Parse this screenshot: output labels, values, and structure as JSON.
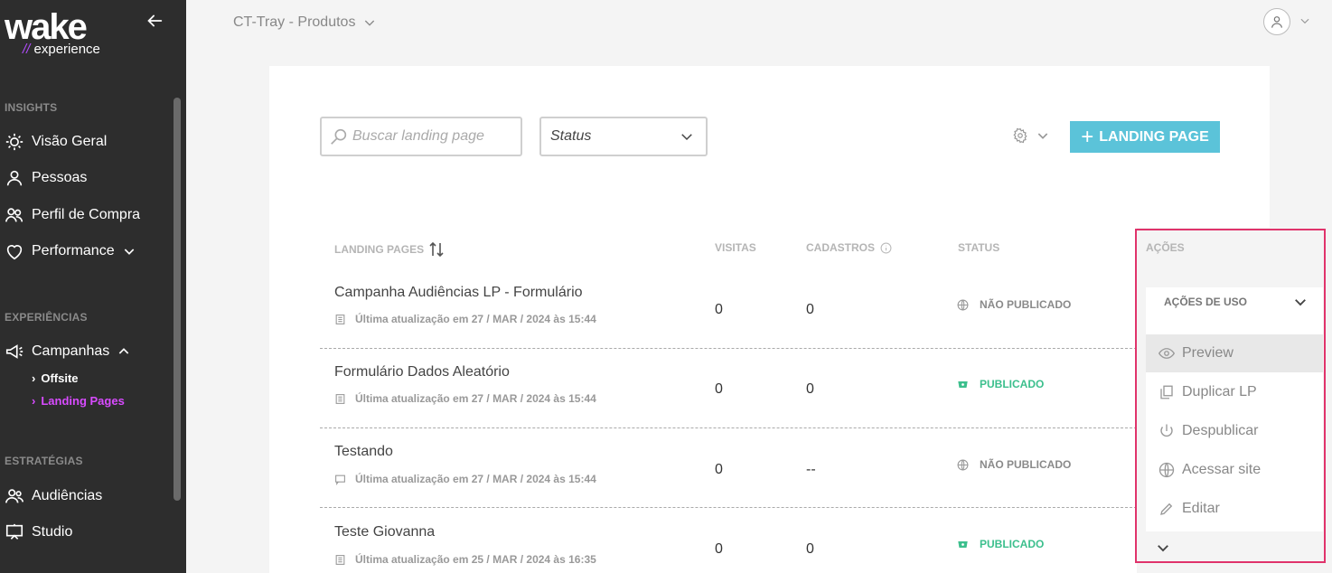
{
  "brand": {
    "logo_text": "wake",
    "logo_sub_slashes": "//",
    "logo_sub": "experience",
    "accent": "#d84bff"
  },
  "sidebar": {
    "sections": [
      {
        "label": "INSIGHTS"
      },
      {
        "label": "EXPERIÊNCIAS"
      },
      {
        "label": "ESTRATÉGIAS"
      }
    ],
    "items": [
      {
        "label": "Visão Geral",
        "icon": "lightbulb-icon"
      },
      {
        "label": "Pessoas",
        "icon": "person-icon"
      },
      {
        "label": "Perfil de Compra",
        "icon": "people-icon"
      },
      {
        "label": "Performance",
        "icon": "heart-icon"
      },
      {
        "label": "Campanhas",
        "icon": "megaphone-icon"
      },
      {
        "label": "Audiências",
        "icon": "audience-icon"
      },
      {
        "label": "Studio",
        "icon": "easel-icon"
      }
    ],
    "sub_items": [
      {
        "label": "Offsite",
        "active": false
      },
      {
        "label": "Landing Pages",
        "active": true
      }
    ]
  },
  "header": {
    "workspace": "CT-Tray - Produtos"
  },
  "toolbar": {
    "search_placeholder": "Buscar landing page",
    "status_label": "Status",
    "add_button_plus": "+",
    "add_button": "LANDING PAGE",
    "button_color": "#5bc3d9"
  },
  "table": {
    "headers": {
      "name": "LANDING PAGES",
      "visits": "VISITAS",
      "signups": "CADASTROS",
      "status": "STATUS",
      "actions": "AÇÕES"
    },
    "rows": [
      {
        "name": "Campanha Audiências LP - Formulário",
        "updated": "Última atualização em 27 / MAR / 2024 às 15:44",
        "visits": "0",
        "signups": "0",
        "status": "NÃO PUBLICADO",
        "published": false
      },
      {
        "name": "Formulário Dados Aleatório",
        "updated": "Última atualização em 27 / MAR / 2024 às 15:44",
        "visits": "0",
        "signups": "0",
        "status": "PUBLICADO",
        "published": true
      },
      {
        "name": "Testando",
        "updated": "Última atualização em 27 / MAR / 2024 às 15:44",
        "visits": "0",
        "signups": "--",
        "status": "NÃO PUBLICADO",
        "published": false
      },
      {
        "name": "Teste Giovanna",
        "updated": "Última atualização em 25 / MAR / 2024 às 16:35",
        "visits": "0",
        "signups": "0",
        "status": "PUBLICADO",
        "published": true
      }
    ]
  },
  "actions_menu": {
    "group_label": "AÇÕES DE USO",
    "items": [
      {
        "label": "Preview",
        "icon": "eye-icon"
      },
      {
        "label": "Duplicar LP",
        "icon": "copy-icon"
      },
      {
        "label": "Despublicar",
        "icon": "power-icon"
      },
      {
        "label": "Acessar site",
        "icon": "globe-icon"
      },
      {
        "label": "Editar",
        "icon": "pencil-icon"
      }
    ],
    "highlight_color": "#e0336b"
  }
}
